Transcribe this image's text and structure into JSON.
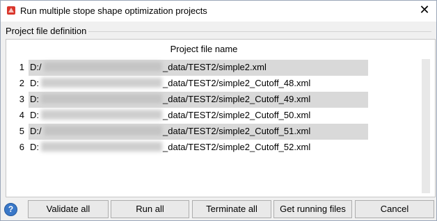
{
  "window": {
    "title": "Run multiple stope shape optimization projects",
    "close_glyph": "✕",
    "icon": "app-icon",
    "accent_color": "#d9362c"
  },
  "section": {
    "label": "Project file definition"
  },
  "table": {
    "column_header": "Project file name",
    "rows": [
      {
        "index": "1",
        "path": "D:/1_Surpac/SSO/simple_demo_data/TEST2/simple2.xml",
        "visible_text": "D:/_data/TEST2/simple2.xml",
        "prefix": "D:/",
        "suffix": "_data/TEST2/simple2.xml",
        "selected": true
      },
      {
        "index": "2",
        "prefix": "D:",
        "suffix": "_data/TEST2/simple2_Cutoff_48.xml",
        "selected": false
      },
      {
        "index": "3",
        "prefix": "D:",
        "suffix": "_data/TEST2/simple2_Cutoff_49.xml",
        "selected": true
      },
      {
        "index": "4",
        "prefix": "D:",
        "suffix": "_data/TEST2/simple2_Cutoff_50.xml",
        "selected": false
      },
      {
        "index": "5",
        "prefix": "D:/",
        "suffix": "_data/TEST2/simple2_Cutoff_51.xml",
        "selected": true
      },
      {
        "index": "6",
        "prefix": "D:",
        "suffix": "_data/TEST2/simple2_Cutoff_52.xml",
        "selected": false
      }
    ]
  },
  "buttons": {
    "help": "?",
    "validate_all": "Validate all",
    "run_all": "Run all",
    "terminate_all": "Terminate all",
    "get_running_files": "Get running files",
    "cancel": "Cancel"
  }
}
